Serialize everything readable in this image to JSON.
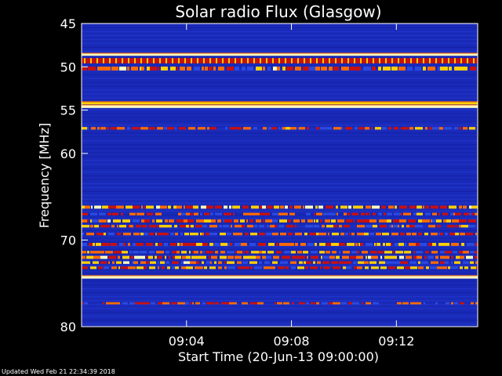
{
  "chart_data": {
    "type": "heatmap",
    "title": "Solar radio Flux (Glasgow)",
    "xlabel": "Start Time (20-Jun-13 09:00:00)",
    "ylabel": "Frequency [MHz]",
    "x_range_minutes": [
      0,
      15.1
    ],
    "ylim": [
      45,
      80
    ],
    "y_inverted": true,
    "xticks": [
      {
        "minute": 4,
        "label": "09:04"
      },
      {
        "minute": 8,
        "label": "09:08"
      },
      {
        "minute": 12,
        "label": "09:12"
      }
    ],
    "yticks": [
      {
        "value": 45,
        "label": "45"
      },
      {
        "value": 50,
        "label": "50"
      },
      {
        "value": 55,
        "label": "55"
      },
      {
        "value": 60,
        "label": "60"
      },
      {
        "value": 70,
        "label": "70"
      },
      {
        "value": 80,
        "label": "80"
      }
    ],
    "colormap": [
      "#0a0a6e",
      "#1432c8",
      "#2a4ae0",
      "#c81010",
      "#ff6a00",
      "#ffd000",
      "#ffffc0"
    ],
    "background_color": "#1a2ab8",
    "emission_bands": [
      {
        "freq_mhz": 48.6,
        "width_mhz": 0.25,
        "intensity": 0.95,
        "kind": "continuous"
      },
      {
        "freq_mhz": 49.3,
        "width_mhz": 0.6,
        "intensity": 0.75,
        "kind": "comb"
      },
      {
        "freq_mhz": 50.2,
        "width_mhz": 0.45,
        "intensity": 0.6,
        "kind": "patchy"
      },
      {
        "freq_mhz": 54.2,
        "width_mhz": 0.25,
        "intensity": 0.9,
        "kind": "continuous"
      },
      {
        "freq_mhz": 54.6,
        "width_mhz": 0.3,
        "intensity": 1.0,
        "kind": "continuous"
      },
      {
        "freq_mhz": 57.1,
        "width_mhz": 0.3,
        "intensity": 0.5,
        "kind": "patchy"
      },
      {
        "freq_mhz": 66.2,
        "width_mhz": 0.35,
        "intensity": 0.7,
        "kind": "patchy"
      },
      {
        "freq_mhz": 67.0,
        "width_mhz": 0.3,
        "intensity": 0.45,
        "kind": "patchy"
      },
      {
        "freq_mhz": 67.8,
        "width_mhz": 0.35,
        "intensity": 0.6,
        "kind": "patchy"
      },
      {
        "freq_mhz": 68.4,
        "width_mhz": 0.3,
        "intensity": 0.5,
        "kind": "patchy"
      },
      {
        "freq_mhz": 69.3,
        "width_mhz": 0.3,
        "intensity": 0.55,
        "kind": "patchy"
      },
      {
        "freq_mhz": 70.5,
        "width_mhz": 0.35,
        "intensity": 0.6,
        "kind": "patchy"
      },
      {
        "freq_mhz": 71.4,
        "width_mhz": 0.3,
        "intensity": 0.55,
        "kind": "patchy"
      },
      {
        "freq_mhz": 72.0,
        "width_mhz": 0.35,
        "intensity": 0.65,
        "kind": "patchy"
      },
      {
        "freq_mhz": 72.6,
        "width_mhz": 0.3,
        "intensity": 0.6,
        "kind": "patchy"
      },
      {
        "freq_mhz": 73.2,
        "width_mhz": 0.3,
        "intensity": 0.55,
        "kind": "patchy"
      },
      {
        "freq_mhz": 74.3,
        "width_mhz": 0.3,
        "intensity": 1.0,
        "kind": "continuous"
      },
      {
        "freq_mhz": 77.3,
        "width_mhz": 0.25,
        "intensity": 0.4,
        "kind": "patchy"
      }
    ]
  },
  "footer": {
    "updated": "Updated Wed Feb 21 22:34:39 2018"
  }
}
